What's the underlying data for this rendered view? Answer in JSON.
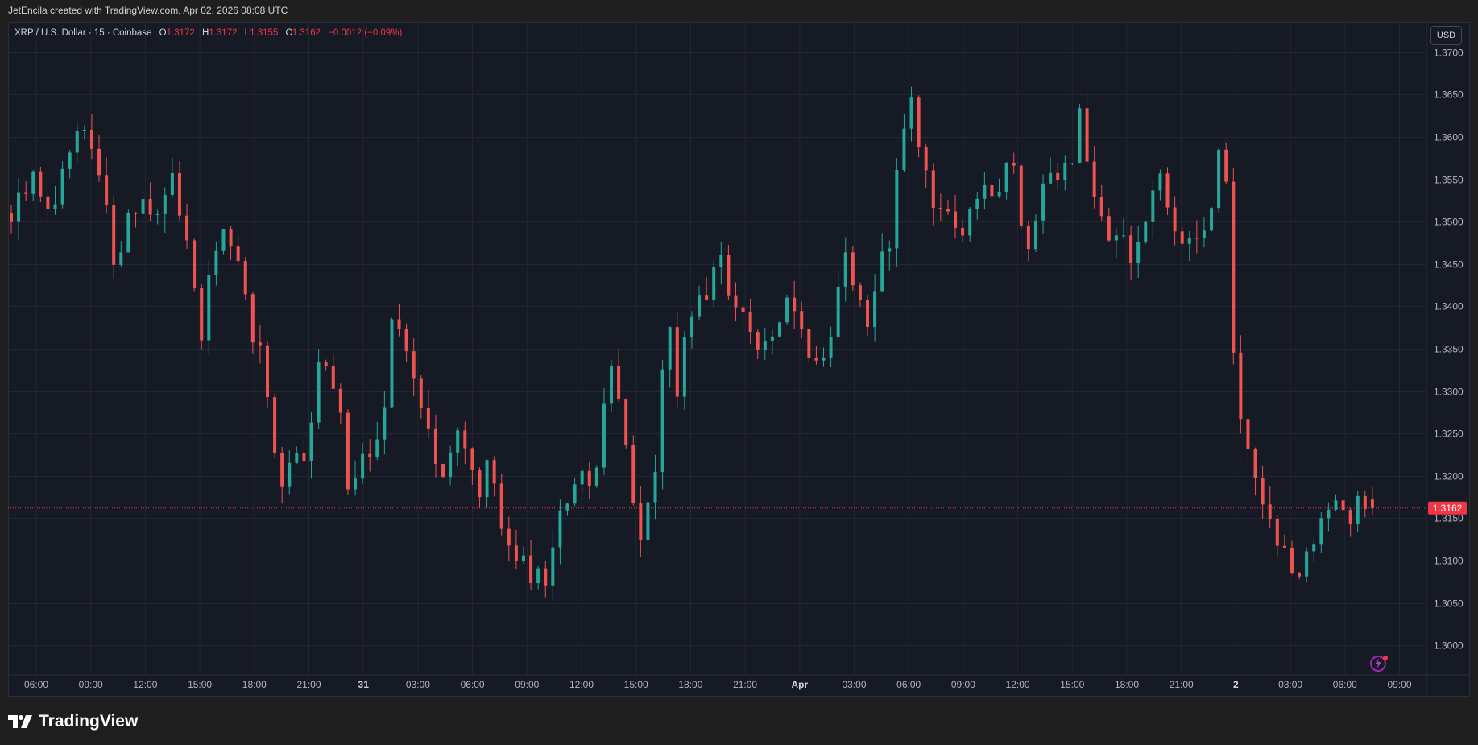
{
  "caption": "JetEncila created with TradingView.com, Apr 02, 2026 08:08 UTC",
  "legend": {
    "symbol": "XRP / U.S. Dollar · 15 · Coinbase",
    "o_label": "O",
    "o": "1.3172",
    "h_label": "H",
    "h": "1.3172",
    "l_label": "L",
    "l": "1.3155",
    "c_label": "C",
    "c": "1.3162",
    "change": "−0.0012 (−0.09%)"
  },
  "currency": "USD",
  "brand": "TradingView",
  "colors": {
    "up": "#26a69a",
    "down": "#ef5350",
    "background": "#161a25",
    "grid": "#232733",
    "text": "#b2b5be",
    "last_price": "#f23645"
  },
  "icons": [
    "tradingview-logo-icon",
    "magic-sparkle-icon"
  ],
  "chart_data": {
    "type": "candlestick",
    "title": "XRP / U.S. Dollar · 15 · Coinbase",
    "interval": "15",
    "y_ticks": [
      "1.3700",
      "1.3650",
      "1.3600",
      "1.3550",
      "1.3500",
      "1.3450",
      "1.3400",
      "1.3350",
      "1.3300",
      "1.3250",
      "1.3200",
      "1.3150",
      "1.3100",
      "1.3050",
      "1.3000"
    ],
    "ylim": [
      1.2965,
      1.3735
    ],
    "x_ticks": [
      "06:00",
      "09:00",
      "12:00",
      "15:00",
      "18:00",
      "21:00",
      "31",
      "03:00",
      "06:00",
      "09:00",
      "12:00",
      "15:00",
      "18:00",
      "21:00",
      "Apr",
      "03:00",
      "06:00",
      "09:00",
      "12:00",
      "15:00",
      "18:00",
      "21:00",
      "2",
      "03:00",
      "06:00",
      "09:00"
    ],
    "bold_ticks": [
      "31",
      "Apr",
      "2"
    ],
    "last_price": 1.3162,
    "last_price_label": "1.3162",
    "path_close": [
      [
        0,
        1.35
      ],
      [
        3,
        1.355
      ],
      [
        6,
        1.351
      ],
      [
        8,
        1.358
      ],
      [
        10,
        1.36
      ],
      [
        12,
        1.355
      ],
      [
        14,
        1.346
      ],
      [
        16,
        1.35
      ],
      [
        18,
        1.353
      ],
      [
        20,
        1.351
      ],
      [
        22,
        1.354
      ],
      [
        24,
        1.349
      ],
      [
        25,
        1.343
      ],
      [
        26,
        1.337
      ],
      [
        27,
        1.342
      ],
      [
        28,
        1.347
      ],
      [
        30,
        1.348
      ],
      [
        32,
        1.34
      ],
      [
        34,
        1.334
      ],
      [
        35,
        1.329
      ],
      [
        36,
        1.321
      ],
      [
        37,
        1.317
      ],
      [
        38,
        1.321
      ],
      [
        40,
        1.323
      ],
      [
        41,
        1.328
      ],
      [
        42,
        1.333
      ],
      [
        43,
        1.332
      ],
      [
        44,
        1.33
      ],
      [
        45,
        1.326
      ],
      [
        46,
        1.32
      ],
      [
        48,
        1.322
      ],
      [
        50,
        1.324
      ],
      [
        51,
        1.327
      ],
      [
        52,
        1.337
      ],
      [
        53,
        1.338
      ],
      [
        54,
        1.336
      ],
      [
        55,
        1.332
      ],
      [
        56,
        1.327
      ],
      [
        57,
        1.325
      ],
      [
        58,
        1.321
      ],
      [
        59,
        1.321
      ],
      [
        60,
        1.324
      ],
      [
        61,
        1.325
      ],
      [
        62,
        1.322
      ],
      [
        63,
        1.321
      ],
      [
        64,
        1.318
      ],
      [
        65,
        1.322
      ],
      [
        66,
        1.318
      ],
      [
        67,
        1.314
      ],
      [
        68,
        1.313
      ],
      [
        69,
        1.311
      ],
      [
        70,
        1.309
      ],
      [
        71,
        1.307
      ],
      [
        72,
        1.31
      ],
      [
        73,
        1.308
      ],
      [
        74,
        1.312
      ],
      [
        75,
        1.315
      ],
      [
        76,
        1.316
      ],
      [
        77,
        1.318
      ],
      [
        78,
        1.32
      ],
      [
        79,
        1.319
      ],
      [
        80,
        1.322
      ],
      [
        81,
        1.328
      ],
      [
        82,
        1.333
      ],
      [
        83,
        1.328
      ],
      [
        84,
        1.323
      ],
      [
        85,
        1.317
      ],
      [
        86,
        1.314
      ],
      [
        87,
        1.318
      ],
      [
        88,
        1.322
      ],
      [
        89,
        1.333
      ],
      [
        90,
        1.337
      ],
      [
        91,
        1.331
      ],
      [
        92,
        1.338
      ],
      [
        93,
        1.34
      ],
      [
        94,
        1.342
      ],
      [
        95,
        1.342
      ],
      [
        96,
        1.343
      ],
      [
        97,
        1.346
      ],
      [
        98,
        1.343
      ],
      [
        99,
        1.34
      ],
      [
        100,
        1.338
      ],
      [
        101,
        1.337
      ],
      [
        102,
        1.336
      ],
      [
        103,
        1.336
      ],
      [
        104,
        1.337
      ],
      [
        105,
        1.339
      ],
      [
        106,
        1.341
      ],
      [
        107,
        1.34
      ],
      [
        108,
        1.336
      ],
      [
        109,
        1.334
      ],
      [
        110,
        1.332
      ],
      [
        111,
        1.333
      ],
      [
        112,
        1.338
      ],
      [
        113,
        1.342
      ],
      [
        114,
        1.345
      ],
      [
        115,
        1.342
      ],
      [
        116,
        1.34
      ],
      [
        117,
        1.337
      ],
      [
        118,
        1.342
      ],
      [
        119,
        1.345
      ],
      [
        120,
        1.347
      ],
      [
        121,
        1.357
      ],
      [
        122,
        1.362
      ],
      [
        123,
        1.364
      ],
      [
        124,
        1.36
      ],
      [
        125,
        1.356
      ],
      [
        126,
        1.353
      ],
      [
        127,
        1.352
      ],
      [
        128,
        1.351
      ],
      [
        129,
        1.35
      ],
      [
        130,
        1.349
      ],
      [
        131,
        1.35
      ],
      [
        132,
        1.353
      ],
      [
        133,
        1.354
      ],
      [
        134,
        1.352
      ],
      [
        135,
        1.355
      ],
      [
        136,
        1.358
      ],
      [
        137,
        1.356
      ],
      [
        138,
        1.351
      ],
      [
        139,
        1.347
      ],
      [
        140,
        1.35
      ],
      [
        141,
        1.353
      ],
      [
        142,
        1.354
      ],
      [
        143,
        1.355
      ],
      [
        144,
        1.357
      ],
      [
        145,
        1.358
      ],
      [
        146,
        1.362
      ],
      [
        147,
        1.357
      ],
      [
        148,
        1.354
      ],
      [
        149,
        1.351
      ],
      [
        150,
        1.349
      ],
      [
        151,
        1.349
      ],
      [
        152,
        1.35
      ],
      [
        153,
        1.346
      ],
      [
        154,
        1.349
      ],
      [
        155,
        1.351
      ],
      [
        156,
        1.355
      ],
      [
        157,
        1.354
      ],
      [
        158,
        1.352
      ],
      [
        159,
        1.35
      ],
      [
        160,
        1.349
      ],
      [
        161,
        1.349
      ],
      [
        162,
        1.349
      ],
      [
        163,
        1.348
      ],
      [
        164,
        1.35
      ],
      [
        165,
        1.357
      ],
      [
        166,
        1.354
      ],
      [
        167,
        1.334
      ],
      [
        168,
        1.326
      ],
      [
        169,
        1.323
      ],
      [
        170,
        1.32
      ],
      [
        171,
        1.317
      ],
      [
        172,
        1.314
      ],
      [
        173,
        1.31
      ],
      [
        174,
        1.312
      ],
      [
        175,
        1.31
      ],
      [
        176,
        1.308
      ],
      [
        177,
        1.31
      ],
      [
        178,
        1.313
      ],
      [
        179,
        1.315
      ],
      [
        180,
        1.316
      ],
      [
        181,
        1.317
      ],
      [
        182,
        1.317
      ],
      [
        183,
        1.315
      ],
      [
        184,
        1.317
      ],
      [
        185,
        1.317
      ],
      [
        186,
        1.3162
      ]
    ]
  }
}
